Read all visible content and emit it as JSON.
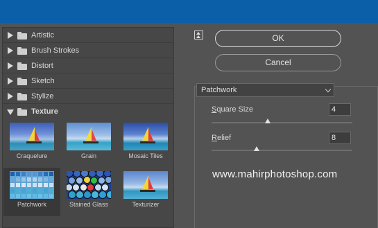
{
  "categories": [
    {
      "label": "Artistic",
      "expanded": false
    },
    {
      "label": "Brush Strokes",
      "expanded": false
    },
    {
      "label": "Distort",
      "expanded": false
    },
    {
      "label": "Sketch",
      "expanded": false
    },
    {
      "label": "Stylize",
      "expanded": false
    },
    {
      "label": "Texture",
      "expanded": true
    }
  ],
  "texture_filters": [
    {
      "label": "Craquelure"
    },
    {
      "label": "Grain"
    },
    {
      "label": "Mosaic Tiles"
    },
    {
      "label": "Patchwork",
      "selected": true
    },
    {
      "label": "Stained Glass"
    },
    {
      "label": "Texturizer"
    }
  ],
  "buttons": {
    "ok": "OK",
    "cancel": "Cancel"
  },
  "filter_select": {
    "value": "Patchwork"
  },
  "params": {
    "square_size": {
      "label_u": "S",
      "label_rest": "quare Size",
      "value": "4",
      "fraction": 0.4
    },
    "relief": {
      "label_u": "R",
      "label_rest": "elief",
      "value": "8",
      "fraction": 0.32
    }
  },
  "watermark": "www.mahirphotoshop.com",
  "colors": {
    "titlebar": "#0a5fa8",
    "panel": "#535353"
  }
}
